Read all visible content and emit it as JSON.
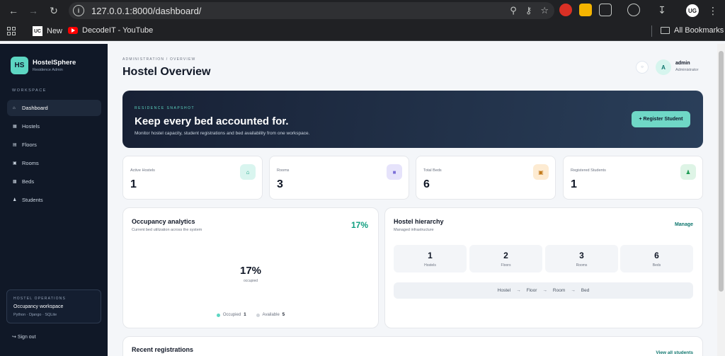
{
  "browser": {
    "url": "127.0.0.1:8000/dashboard/",
    "bookmarks": [
      {
        "label": "New"
      },
      {
        "label": "DecodeIT - YouTube"
      }
    ],
    "all_bookmarks": "All Bookmarks",
    "profile_initials": "UG"
  },
  "sidebar": {
    "logo": "HS",
    "brand": "HostelSphere",
    "brand_sub": "Residence Admin",
    "section": "WORKSPACE",
    "items": [
      {
        "label": "Dashboard",
        "icon": "home-icon"
      },
      {
        "label": "Hostels",
        "icon": "building-icon"
      },
      {
        "label": "Floors",
        "icon": "layers-icon"
      },
      {
        "label": "Rooms",
        "icon": "door-icon"
      },
      {
        "label": "Beds",
        "icon": "bed-icon"
      },
      {
        "label": "Students",
        "icon": "user-icon"
      }
    ],
    "ops": {
      "label": "HOSTEL OPERATIONS",
      "title": "Occupancy workspace",
      "stack": "Python · Django · SQLite"
    },
    "signout": "Sign out"
  },
  "header": {
    "breadcrumb": "ADMINISTRATION / OVERVIEW",
    "title": "Hostel Overview",
    "user": {
      "initial": "A",
      "name": "admin",
      "role": "Administrator"
    }
  },
  "hero": {
    "eyebrow": "RESIDENCE SNAPSHOT",
    "title": "Keep every bed accounted for.",
    "subtitle": "Monitor hostel capacity, student registrations and bed availability from one workspace.",
    "button": "+ Register Student"
  },
  "stats": [
    {
      "label": "Active Hostels",
      "value": "1",
      "icon": "home-icon",
      "color": "#d9f5ef",
      "icon_color": "#0f9e7f"
    },
    {
      "label": "Rooms",
      "value": "3",
      "icon": "square-icon",
      "color": "#e6e3fb",
      "icon_color": "#7c6fd8"
    },
    {
      "label": "Total Beds",
      "value": "6",
      "icon": "bed-icon",
      "color": "#fdebd2",
      "icon_color": "#c27a1a"
    },
    {
      "label": "Registered Students",
      "value": "1",
      "icon": "user-icon",
      "color": "#def4e6",
      "icon_color": "#1f9d55"
    }
  ],
  "occupancy": {
    "title": "Occupancy analytics",
    "subtitle": "Current bed utilization across the system",
    "percent": "17%",
    "center_label": "occupied",
    "legend": [
      {
        "label": "Occupied",
        "value": "1",
        "color": "#5dd6c2"
      },
      {
        "label": "Available",
        "value": "5",
        "color": "#d1d5db"
      }
    ]
  },
  "hierarchy": {
    "title": "Hostel hierarchy",
    "subtitle": "Managed infrastructure",
    "manage": "Manage",
    "boxes": [
      {
        "value": "1",
        "label": "Hostels"
      },
      {
        "value": "2",
        "label": "Floors"
      },
      {
        "value": "3",
        "label": "Rooms"
      },
      {
        "value": "6",
        "label": "Beds"
      }
    ],
    "flow": [
      "Hostel",
      "Floor",
      "Room",
      "Bed"
    ]
  },
  "recent": {
    "title": "Recent registrations",
    "link": "View all students"
  }
}
